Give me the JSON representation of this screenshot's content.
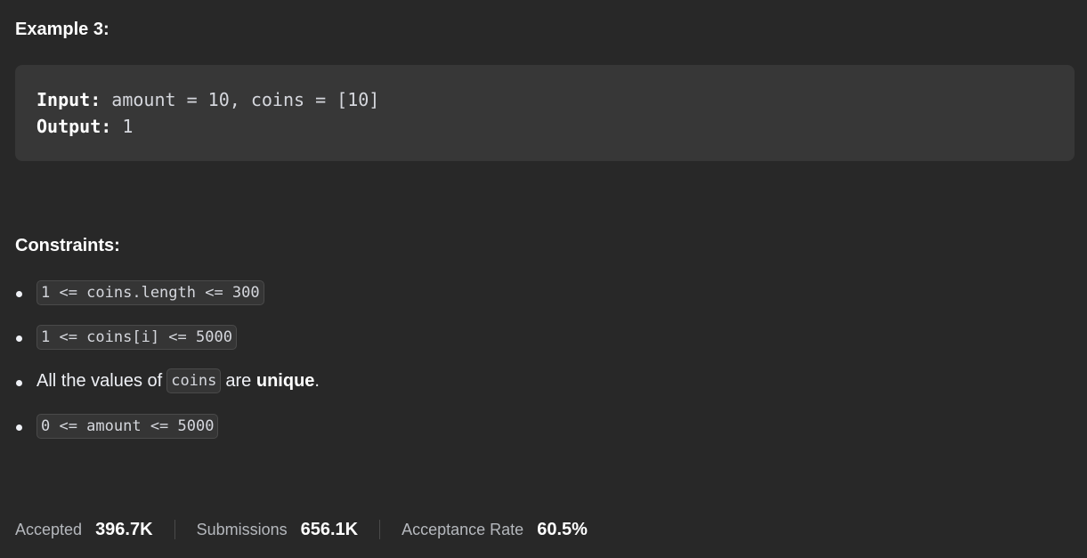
{
  "example": {
    "title": "Example 3:",
    "input_key": "Input:",
    "input_value": " amount = 10, coins = [10]",
    "output_key": "Output:",
    "output_value": " 1"
  },
  "constraints": {
    "title": "Constraints:",
    "items": [
      {
        "code": "1 <= coins.length <= 300"
      },
      {
        "code": "1 <= coins[i] <= 5000"
      },
      {
        "text_before": "All the values of",
        "code": "coins",
        "text_mid": "are",
        "strong": "unique",
        "text_after": "."
      },
      {
        "code": "0 <= amount <= 5000"
      }
    ]
  },
  "stats": {
    "accepted_label": "Accepted",
    "accepted_value": "396.7K",
    "submissions_label": "Submissions",
    "submissions_value": "656.1K",
    "rate_label": "Acceptance Rate",
    "rate_value": "60.5%"
  }
}
